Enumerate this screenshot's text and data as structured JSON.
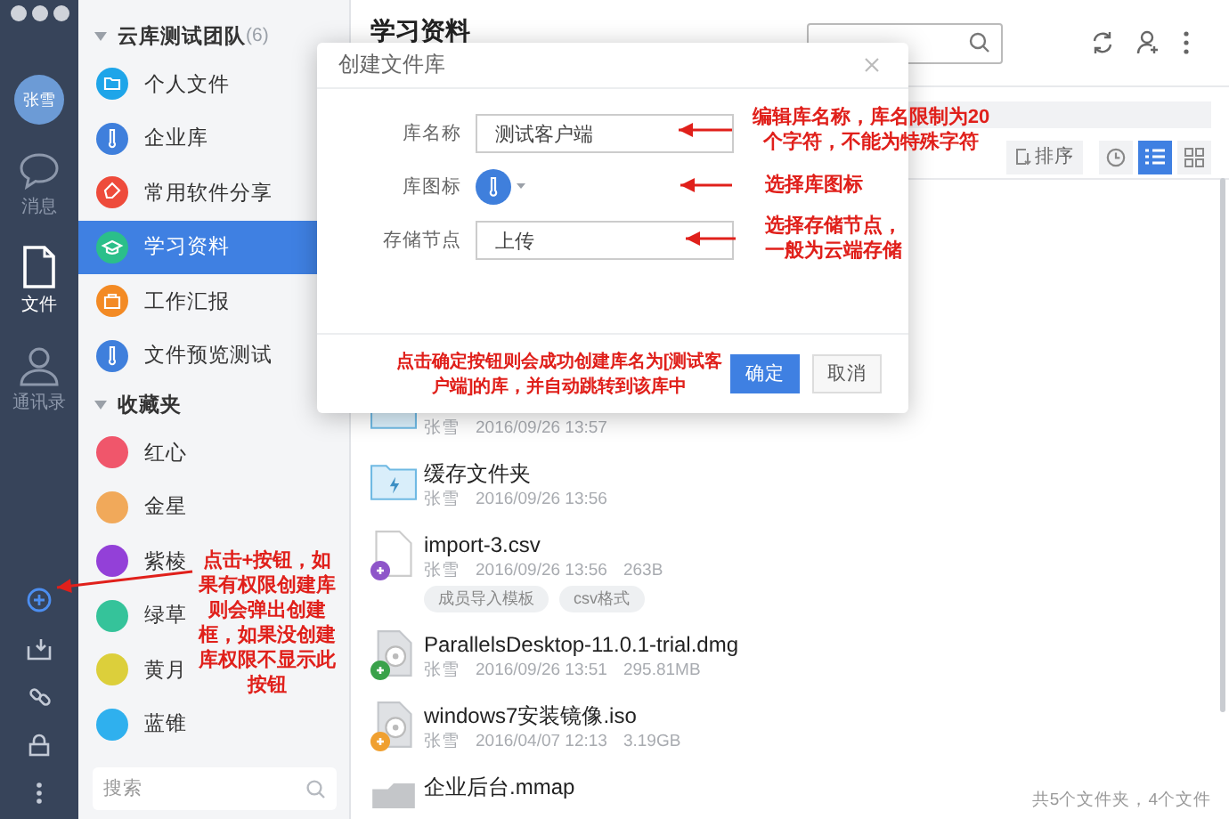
{
  "rail": {
    "avatar": "张雪",
    "nav": [
      {
        "kind": "chat",
        "label": "消息",
        "selected": false
      },
      {
        "kind": "file",
        "label": "文件",
        "selected": true
      },
      {
        "kind": "contacts",
        "label": "通讯录",
        "selected": false
      }
    ],
    "tools": [
      {
        "kind": "add"
      },
      {
        "kind": "inbox"
      },
      {
        "kind": "link"
      },
      {
        "kind": "lock"
      },
      {
        "kind": "more"
      }
    ]
  },
  "sidebar": {
    "groups": [
      {
        "title": "云库测试团队",
        "count": "(6)",
        "expanded": true,
        "items": [
          {
            "label": "个人文件",
            "kind": "folder",
            "color": "#1ea5e9",
            "selected": false
          },
          {
            "label": "企业库",
            "kind": "library",
            "color": "#3f7fdc",
            "selected": false
          },
          {
            "label": "常用软件分享",
            "kind": "tag",
            "color": "#ee4b3b",
            "selected": false
          },
          {
            "label": "学习资料",
            "kind": "cap",
            "color": "#2bbf8a",
            "selected": true
          },
          {
            "label": "工作汇报",
            "kind": "bag",
            "color": "#f38a24",
            "selected": false
          },
          {
            "label": "文件预览测试",
            "kind": "library",
            "color": "#3f7fdc",
            "selected": false
          }
        ]
      },
      {
        "title": "收藏夹",
        "expanded": true,
        "items": [
          {
            "label": "红心",
            "kind": "dot",
            "color": "#f0566b",
            "selected": false
          },
          {
            "label": "金星",
            "kind": "dot",
            "color": "#f1a95a",
            "selected": false
          },
          {
            "label": "紫棱",
            "kind": "dot",
            "color": "#9340d8",
            "selected": false
          },
          {
            "label": "绿草",
            "kind": "dot",
            "color": "#35c39a",
            "selected": false
          },
          {
            "label": "黄月",
            "kind": "dot",
            "color": "#dccf3b",
            "selected": false
          },
          {
            "label": "蓝锥",
            "kind": "dot",
            "color": "#2fb0ee",
            "selected": false
          }
        ]
      }
    ],
    "search": {
      "placeholder": "搜索"
    }
  },
  "main": {
    "title": "学习资料",
    "sort": "排序",
    "views": [
      {
        "kind": "recent",
        "selected": false
      },
      {
        "kind": "list",
        "selected": true
      },
      {
        "kind": "grid",
        "selected": false
      }
    ],
    "files": [
      {
        "kind": "folder",
        "owner": "张雪",
        "time": "2016/09/26 13:57"
      },
      {
        "kind": "cache-folder",
        "name": "缓存文件夹",
        "owner": "张雪",
        "time": "2016/09/26 13:56"
      },
      {
        "kind": "doc",
        "name": "import-3.csv",
        "owner": "张雪",
        "time": "2016/09/26 13:56",
        "size": "263B",
        "color": "#8e55c9",
        "tags": [
          "成员导入模板",
          "csv格式"
        ]
      },
      {
        "kind": "disc",
        "name": "ParallelsDesktop-11.0.1-trial.dmg",
        "owner": "张雪",
        "time": "2016/09/26 13:51",
        "size": "295.81MB",
        "color": "#3aa24a"
      },
      {
        "kind": "disc",
        "name": "windows7安装镜像.iso",
        "owner": "张雪",
        "time": "2016/04/07 12:13",
        "size": "3.19GB",
        "color": "#f0a030"
      },
      {
        "kind": "mindmap",
        "name": "企业后台.mmap"
      }
    ],
    "status": "共5个文件夹，4个文件"
  },
  "dialog": {
    "title": "创建文件库",
    "fields": [
      {
        "kind": "text",
        "label": "库名称",
        "value": "测试客户端"
      },
      {
        "kind": "icon",
        "label": "库图标"
      },
      {
        "kind": "text",
        "label": "存储节点",
        "value": "上传"
      }
    ],
    "buttons": [
      {
        "label": "确定",
        "primary": true
      },
      {
        "label": "取消",
        "primary": false
      }
    ]
  },
  "annotations": [
    {
      "text": "编辑库名称，库名限制为20个字符，不能为特殊字符"
    },
    {
      "text": "选择库图标"
    },
    {
      "text": "选择存储节点，一般为云端存储"
    },
    {
      "text": "点击确定按钮则会成功创建库名为[测试客户端]的库，并自动跳转到该库中"
    },
    {
      "text": "点击+按钮，如果有权限创建库则会弹出创建框，如果没创建库权限不显示此按钮"
    }
  ]
}
